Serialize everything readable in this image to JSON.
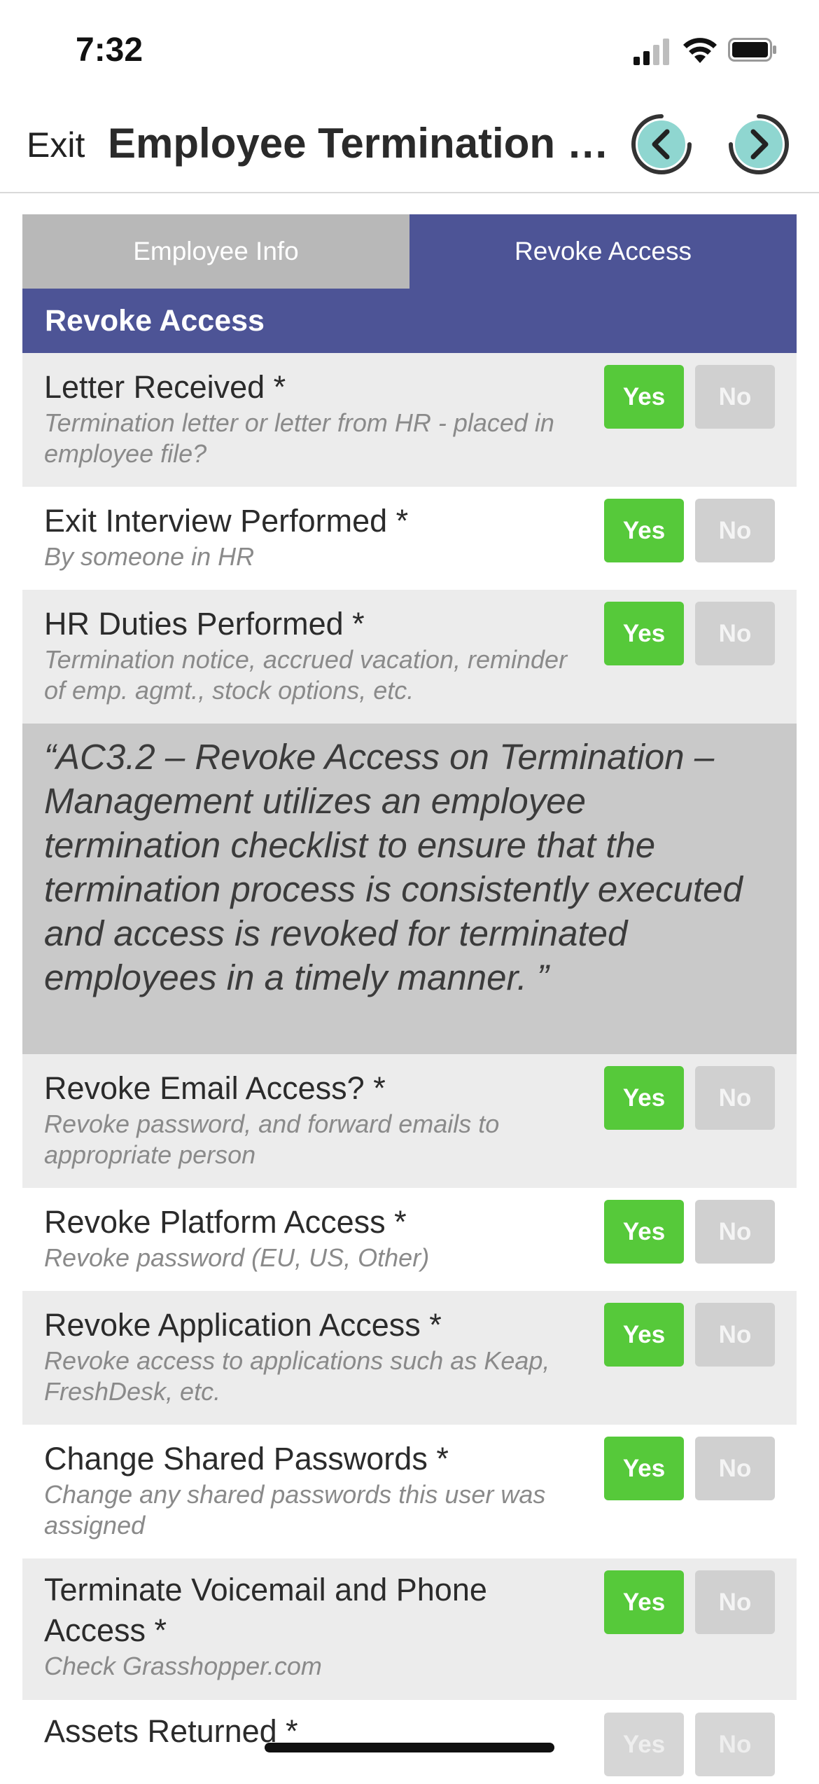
{
  "status_bar": {
    "time": "7:32"
  },
  "nav": {
    "exit_label": "Exit",
    "title": "Employee Termination C...",
    "prev_icon": "chevron-left-circle-icon",
    "next_icon": "chevron-right-circle-icon",
    "accent": "#8fd6d0"
  },
  "tabs": [
    {
      "label": "Employee Info",
      "active": false
    },
    {
      "label": "Revoke Access",
      "active": true
    }
  ],
  "section_header": "Revoke Access",
  "colors": {
    "header": "#4d5496",
    "yes": "#56c93a",
    "no": "#d0d0d0"
  },
  "rows_a": [
    {
      "title": "Letter Received *",
      "subtitle": "Termination letter or letter from HR - placed in employee file?",
      "yes": "Yes",
      "no": "No",
      "selected": "Yes"
    },
    {
      "title": "Exit Interview Performed *",
      "subtitle": "By someone in HR",
      "yes": "Yes",
      "no": "No",
      "selected": "Yes"
    },
    {
      "title": "HR Duties Performed *",
      "subtitle": "Termination notice, accrued vacation, reminder of emp. agmt., stock options, etc.",
      "yes": "Yes",
      "no": "No",
      "selected": "Yes"
    }
  ],
  "quote": "“AC3.2 – Revoke Access on Termination – Management utilizes an employee termination checklist to ensure that the termination process is consistently executed and access is revoked for terminated employees in a timely manner. ”",
  "rows_b": [
    {
      "title": "Revoke Email Access? *",
      "subtitle": "Revoke password, and forward emails to appropriate person",
      "yes": "Yes",
      "no": "No",
      "selected": "Yes"
    },
    {
      "title": "Revoke Platform Access *",
      "subtitle": "Revoke password (EU, US, Other)",
      "yes": "Yes",
      "no": "No",
      "selected": "Yes"
    },
    {
      "title": "Revoke Application Access *",
      "subtitle": "Revoke access to applications such as Keap, FreshDesk, etc.",
      "yes": "Yes",
      "no": "No",
      "selected": "Yes"
    },
    {
      "title": "Change Shared Passwords *",
      "subtitle": "Change any shared passwords this user was assigned",
      "yes": "Yes",
      "no": "No",
      "selected": "Yes"
    },
    {
      "title": "Terminate Voicemail and Phone Access *",
      "subtitle": "Check Grasshopper.com",
      "yes": "Yes",
      "no": "No",
      "selected": "Yes"
    },
    {
      "title": "Assets Returned *",
      "subtitle": "",
      "yes": "Yes",
      "no": "No",
      "selected": ""
    }
  ]
}
